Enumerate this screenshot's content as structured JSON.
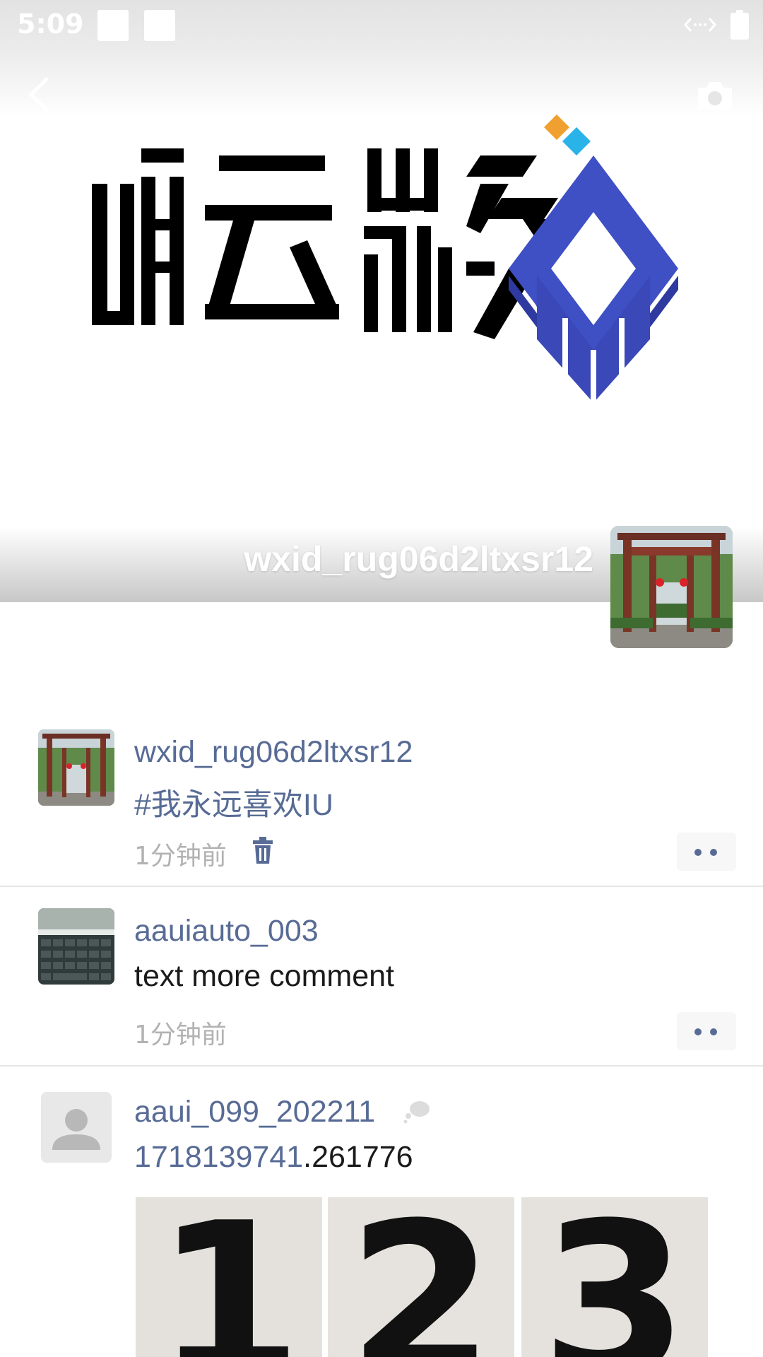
{
  "status_bar": {
    "time": "5:09"
  },
  "profile": {
    "name": "wxid_rug06d2ltxsr12"
  },
  "posts": [
    {
      "name": "wxid_rug06d2ltxsr12",
      "text": "#我永远喜欢IU",
      "time": "1分钟前"
    },
    {
      "name": "aauiauto_003",
      "text": "text more comment",
      "time": "1分钟前"
    },
    {
      "name": "aaui_099_202211",
      "text_link": "1718139741",
      "text_rest": ".261776",
      "photos": [
        "1",
        "2",
        "3"
      ]
    }
  ],
  "colors": {
    "link": "#576b95",
    "brand_blue": "#3f4fc4",
    "accent_orange": "#f0a030",
    "accent_cyan": "#2ab3e8"
  }
}
